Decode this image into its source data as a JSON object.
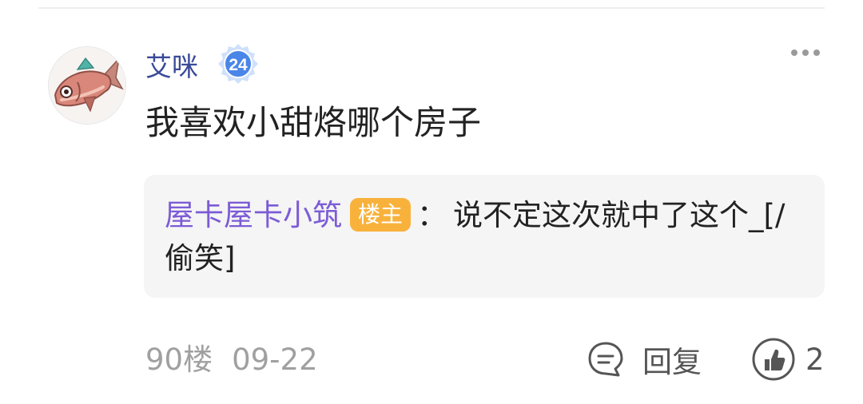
{
  "comment": {
    "username": "艾咪",
    "level": "24",
    "text": "我喜欢小甜烙哪个房子",
    "reply": {
      "author": "屋卡屋卡小筑",
      "author_badge": "楼主",
      "separator": "：",
      "text": "说不定这次就中了这个_[/偷笑]"
    },
    "floor": "90楼",
    "date": "09-22",
    "reply_label": "回复",
    "like_count": "2"
  },
  "icons": {
    "avatar": "fish-avatar",
    "level_badge": "level-badge-icon",
    "more": "more-dots-icon",
    "reply": "comment-bubble-icon",
    "like": "thumb-up-icon"
  },
  "colors": {
    "username": "#3a4a99",
    "reply_author": "#7c5cd6",
    "op_badge": "#f8b23c",
    "reply_box_bg": "#f5f5f5",
    "meta_text": "#a0a0a0"
  }
}
